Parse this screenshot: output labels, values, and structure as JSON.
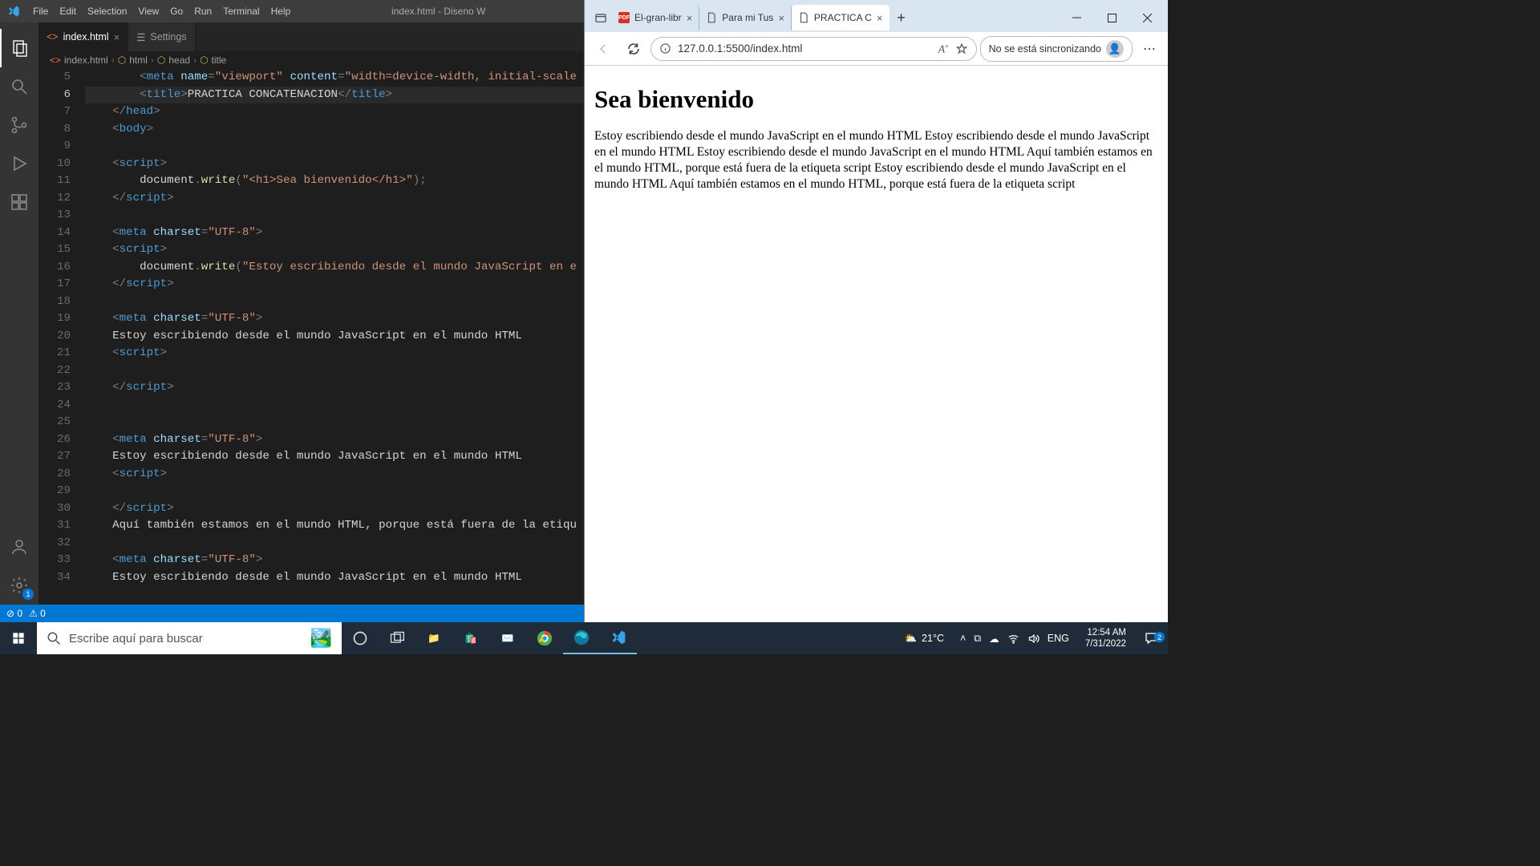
{
  "vscode": {
    "menus": [
      "File",
      "Edit",
      "Selection",
      "View",
      "Go",
      "Run",
      "Terminal",
      "Help"
    ],
    "window_title": "index.html - Diseno W",
    "tabs": [
      {
        "label": "index.html",
        "active": true,
        "icon": "code-file-icon"
      },
      {
        "label": "Settings",
        "active": false,
        "icon": "settings-icon"
      }
    ],
    "breadcrumb": [
      "index.html",
      "html",
      "head",
      "title"
    ],
    "status": {
      "errors": "0",
      "warnings": "0"
    },
    "gutter_start": 5,
    "lines": [
      {
        "n": 5,
        "html": "        <span class='tk-tag'>&lt;</span><span class='tk-el'>meta</span> <span class='tk-attr'>name</span><span class='tk-tag'>=</span><span class='tk-str'>\"viewport\"</span> <span class='tk-attr'>content</span><span class='tk-tag'>=</span><span class='tk-str'>\"width=device-width, initial-scale</span>"
      },
      {
        "n": 6,
        "current": true,
        "html": "        <span class='tk-tag'>&lt;</span><span class='tk-el'>title</span><span class='tk-tag'>&gt;</span><span class='tk-txt'>PRACTICA CONCATENACION</span><span class='tk-tag'>&lt;/</span><span class='tk-el'>title</span><span class='tk-tag'>&gt;</span>"
      },
      {
        "n": 7,
        "html": "    <span class='tk-tag'>&lt;/</span><span class='tk-el'>head</span><span class='tk-tag'>&gt;</span>"
      },
      {
        "n": 8,
        "html": "    <span class='tk-tag'>&lt;</span><span class='tk-el'>body</span><span class='tk-tag'>&gt;</span>"
      },
      {
        "n": 9,
        "html": ""
      },
      {
        "n": 10,
        "html": "    <span class='tk-tag'>&lt;</span><span class='tk-el'>script</span><span class='tk-tag'>&gt;</span>"
      },
      {
        "n": 11,
        "html": "        <span class='tk-txt'>document</span><span class='tk-tag'>.</span><span class='tk-fn'>write</span><span class='tk-tag'>(</span><span class='tk-str'>\"&lt;h1&gt;Sea bienvenido&lt;/h1&gt;\"</span><span class='tk-tag'>);</span>"
      },
      {
        "n": 12,
        "html": "    <span class='tk-tag'>&lt;/</span><span class='tk-el'>script</span><span class='tk-tag'>&gt;</span>"
      },
      {
        "n": 13,
        "html": ""
      },
      {
        "n": 14,
        "html": "    <span class='tk-tag'>&lt;</span><span class='tk-el'>meta</span> <span class='tk-attr'>charset</span><span class='tk-tag'>=</span><span class='tk-str'>\"UTF-8\"</span><span class='tk-tag'>&gt;</span>"
      },
      {
        "n": 15,
        "html": "    <span class='tk-tag'>&lt;</span><span class='tk-el'>script</span><span class='tk-tag'>&gt;</span>"
      },
      {
        "n": 16,
        "html": "        <span class='tk-txt'>document</span><span class='tk-tag'>.</span><span class='tk-fn'>write</span><span class='tk-tag'>(</span><span class='tk-str'>\"Estoy escribiendo desde el mundo JavaScript en e</span>"
      },
      {
        "n": 17,
        "html": "    <span class='tk-tag'>&lt;/</span><span class='tk-el'>script</span><span class='tk-tag'>&gt;</span>"
      },
      {
        "n": 18,
        "html": ""
      },
      {
        "n": 19,
        "html": "    <span class='tk-tag'>&lt;</span><span class='tk-el'>meta</span> <span class='tk-attr'>charset</span><span class='tk-tag'>=</span><span class='tk-str'>\"UTF-8\"</span><span class='tk-tag'>&gt;</span>"
      },
      {
        "n": 20,
        "html": "    <span class='tk-txt'>Estoy escribiendo desde el mundo JavaScript en el mundo HTML</span>"
      },
      {
        "n": 21,
        "html": "    <span class='tk-tag'>&lt;</span><span class='tk-el'>script</span><span class='tk-tag'>&gt;</span>"
      },
      {
        "n": 22,
        "html": ""
      },
      {
        "n": 23,
        "html": "    <span class='tk-tag'>&lt;/</span><span class='tk-el'>script</span><span class='tk-tag'>&gt;</span>"
      },
      {
        "n": 24,
        "html": ""
      },
      {
        "n": 25,
        "html": ""
      },
      {
        "n": 26,
        "html": "    <span class='tk-tag'>&lt;</span><span class='tk-el'>meta</span> <span class='tk-attr'>charset</span><span class='tk-tag'>=</span><span class='tk-str'>\"UTF-8\"</span><span class='tk-tag'>&gt;</span>"
      },
      {
        "n": 27,
        "html": "    <span class='tk-txt'>Estoy escribiendo desde el mundo JavaScript en el mundo HTML</span>"
      },
      {
        "n": 28,
        "html": "    <span class='tk-tag'>&lt;</span><span class='tk-el'>script</span><span class='tk-tag'>&gt;</span>"
      },
      {
        "n": 29,
        "html": ""
      },
      {
        "n": 30,
        "html": "    <span class='tk-tag'>&lt;/</span><span class='tk-el'>script</span><span class='tk-tag'>&gt;</span>"
      },
      {
        "n": 31,
        "html": "    <span class='tk-txt'>Aquí también estamos en el mundo HTML, porque está fuera de la etiqu</span>"
      },
      {
        "n": 32,
        "html": ""
      },
      {
        "n": 33,
        "html": "    <span class='tk-tag'>&lt;</span><span class='tk-el'>meta</span> <span class='tk-attr'>charset</span><span class='tk-tag'>=</span><span class='tk-str'>\"UTF-8\"</span><span class='tk-tag'>&gt;</span>"
      },
      {
        "n": 34,
        "html": "    <span class='tk-txt'>Estoy escribiendo desde el mundo JavaScript en el mundo HTML</span>"
      }
    ]
  },
  "edge": {
    "tabs": [
      {
        "label": "El-gran-libr",
        "icon": "pdf-icon",
        "active": false
      },
      {
        "label": "Para mi Tus",
        "icon": "file-icon",
        "active": false
      },
      {
        "label": "PRACTICA C",
        "icon": "file-icon",
        "active": true
      }
    ],
    "url": "127.0.0.1:5500/index.html",
    "sync_label": "No se está sincronizando",
    "page_heading": "Sea bienvenido",
    "page_body": "Estoy escribiendo desde el mundo JavaScript en el mundo HTML Estoy escribiendo desde el mundo JavaScript en el mundo HTML Estoy escribiendo desde el mundo JavaScript en el mundo HTML Aquí también estamos en el mundo HTML, porque está fuera de la etiqueta script Estoy escribiendo desde el mundo JavaScript en el mundo HTML Aquí también estamos en el mundo HTML, porque está fuera de la etiqueta script"
  },
  "taskbar": {
    "search_placeholder": "Escribe aquí para buscar",
    "weather": "21°C",
    "lang": "ENG",
    "time": "12:54 AM",
    "date": "7/31/2022"
  }
}
